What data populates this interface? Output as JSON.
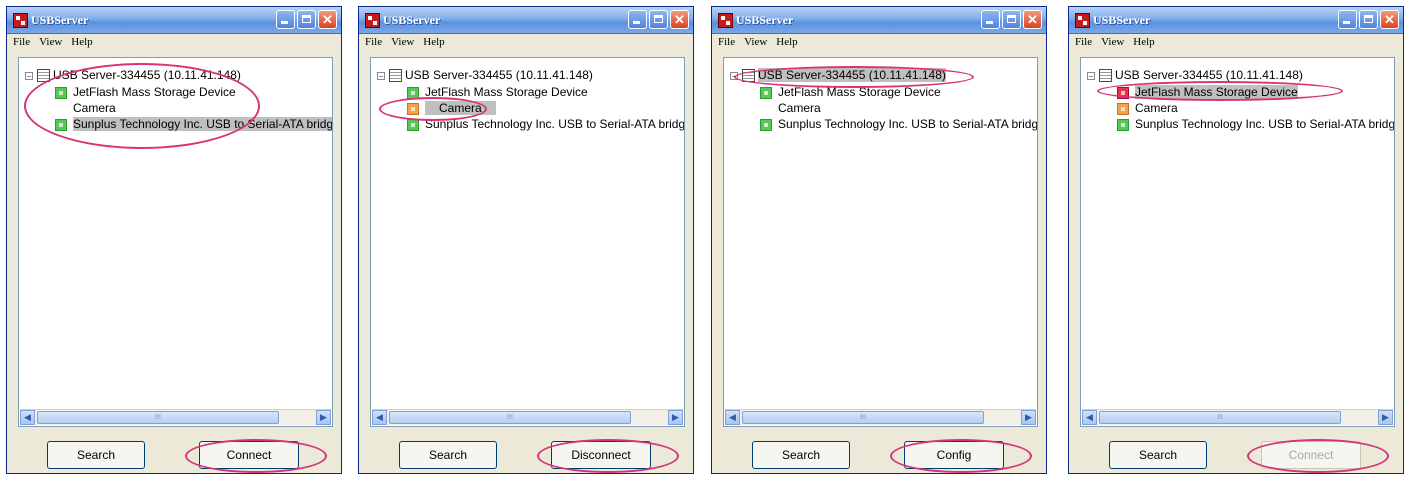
{
  "colors": {
    "highlight_ring": "#d6337a",
    "status_green": "#58c858",
    "status_orange": "#f1a24a",
    "status_red": "#e8334a"
  },
  "panels": [
    {
      "title": "USBServer",
      "menu": [
        "File",
        "View",
        "Help"
      ],
      "server": "USB Server-334455 (10.11.41.148)",
      "devices": [
        {
          "label": "JetFlash Mass Storage Device",
          "status": "green",
          "selected": false
        },
        {
          "label": "Camera",
          "status": "none",
          "selected": false
        },
        {
          "label": "Sunplus Technology Inc. USB to Serial-ATA bridge",
          "status": "green",
          "selected": true
        }
      ],
      "server_selected": false,
      "scrollbar_thumb": "III",
      "search_label": "Search",
      "action_label": "Connect",
      "action_disabled": false
    },
    {
      "title": "USBServer",
      "menu": [
        "File",
        "View",
        "Help"
      ],
      "server": "USB Server-334455 (10.11.41.148)",
      "devices": [
        {
          "label": "JetFlash Mass Storage Device",
          "status": "green",
          "selected": false
        },
        {
          "label": "Camera",
          "status": "orange",
          "selected": true
        },
        {
          "label": "Sunplus Technology Inc. USB to Serial-ATA bridge",
          "status": "green",
          "selected": false
        }
      ],
      "server_selected": false,
      "scrollbar_thumb": "III",
      "search_label": "Search",
      "action_label": "Disconnect",
      "action_disabled": false
    },
    {
      "title": "USBServer",
      "menu": [
        "File",
        "View",
        "Help"
      ],
      "server": "USB Server-334455 (10.11.41.148)",
      "devices": [
        {
          "label": "JetFlash Mass Storage Device",
          "status": "green",
          "selected": false
        },
        {
          "label": "Camera",
          "status": "none",
          "selected": false
        },
        {
          "label": "Sunplus Technology Inc. USB to Serial-ATA bridge",
          "status": "green",
          "selected": false
        }
      ],
      "server_selected": true,
      "scrollbar_thumb": "III",
      "search_label": "Search",
      "action_label": "Config",
      "action_disabled": false
    },
    {
      "title": "USBServer",
      "menu": [
        "File",
        "View",
        "Help"
      ],
      "server": "USB Server-334455 (10.11.41.148)",
      "devices": [
        {
          "label": "JetFlash Mass Storage Device",
          "status": "red",
          "selected": true
        },
        {
          "label": "Camera",
          "status": "orange",
          "selected": false
        },
        {
          "label": "Sunplus Technology Inc. USB to Serial-ATA bridge",
          "status": "green",
          "selected": false
        }
      ],
      "server_selected": false,
      "scrollbar_thumb": "III",
      "search_label": "Search",
      "action_label": "Connect",
      "action_disabled": true
    }
  ]
}
